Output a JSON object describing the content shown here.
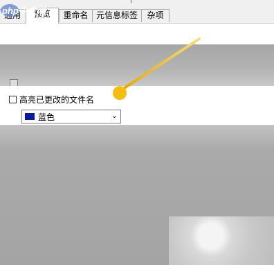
{
  "window": {
    "title_fragment": "↑"
  },
  "tabs": [
    {
      "label": "通用",
      "active": false
    },
    {
      "label": "预览",
      "active": true
    },
    {
      "label": "重命名",
      "active": false
    },
    {
      "label": "元信息标签",
      "active": false
    },
    {
      "label": "杂项",
      "active": false
    }
  ],
  "highlight_option": {
    "label": "高亮已更改的文件名",
    "checked": false,
    "color_select": {
      "value": "蓝色",
      "swatch_color": "#0a1a9e"
    }
  },
  "watermark": {
    "text": "php中文网"
  },
  "colors": {
    "pointer": "#f4b400"
  }
}
